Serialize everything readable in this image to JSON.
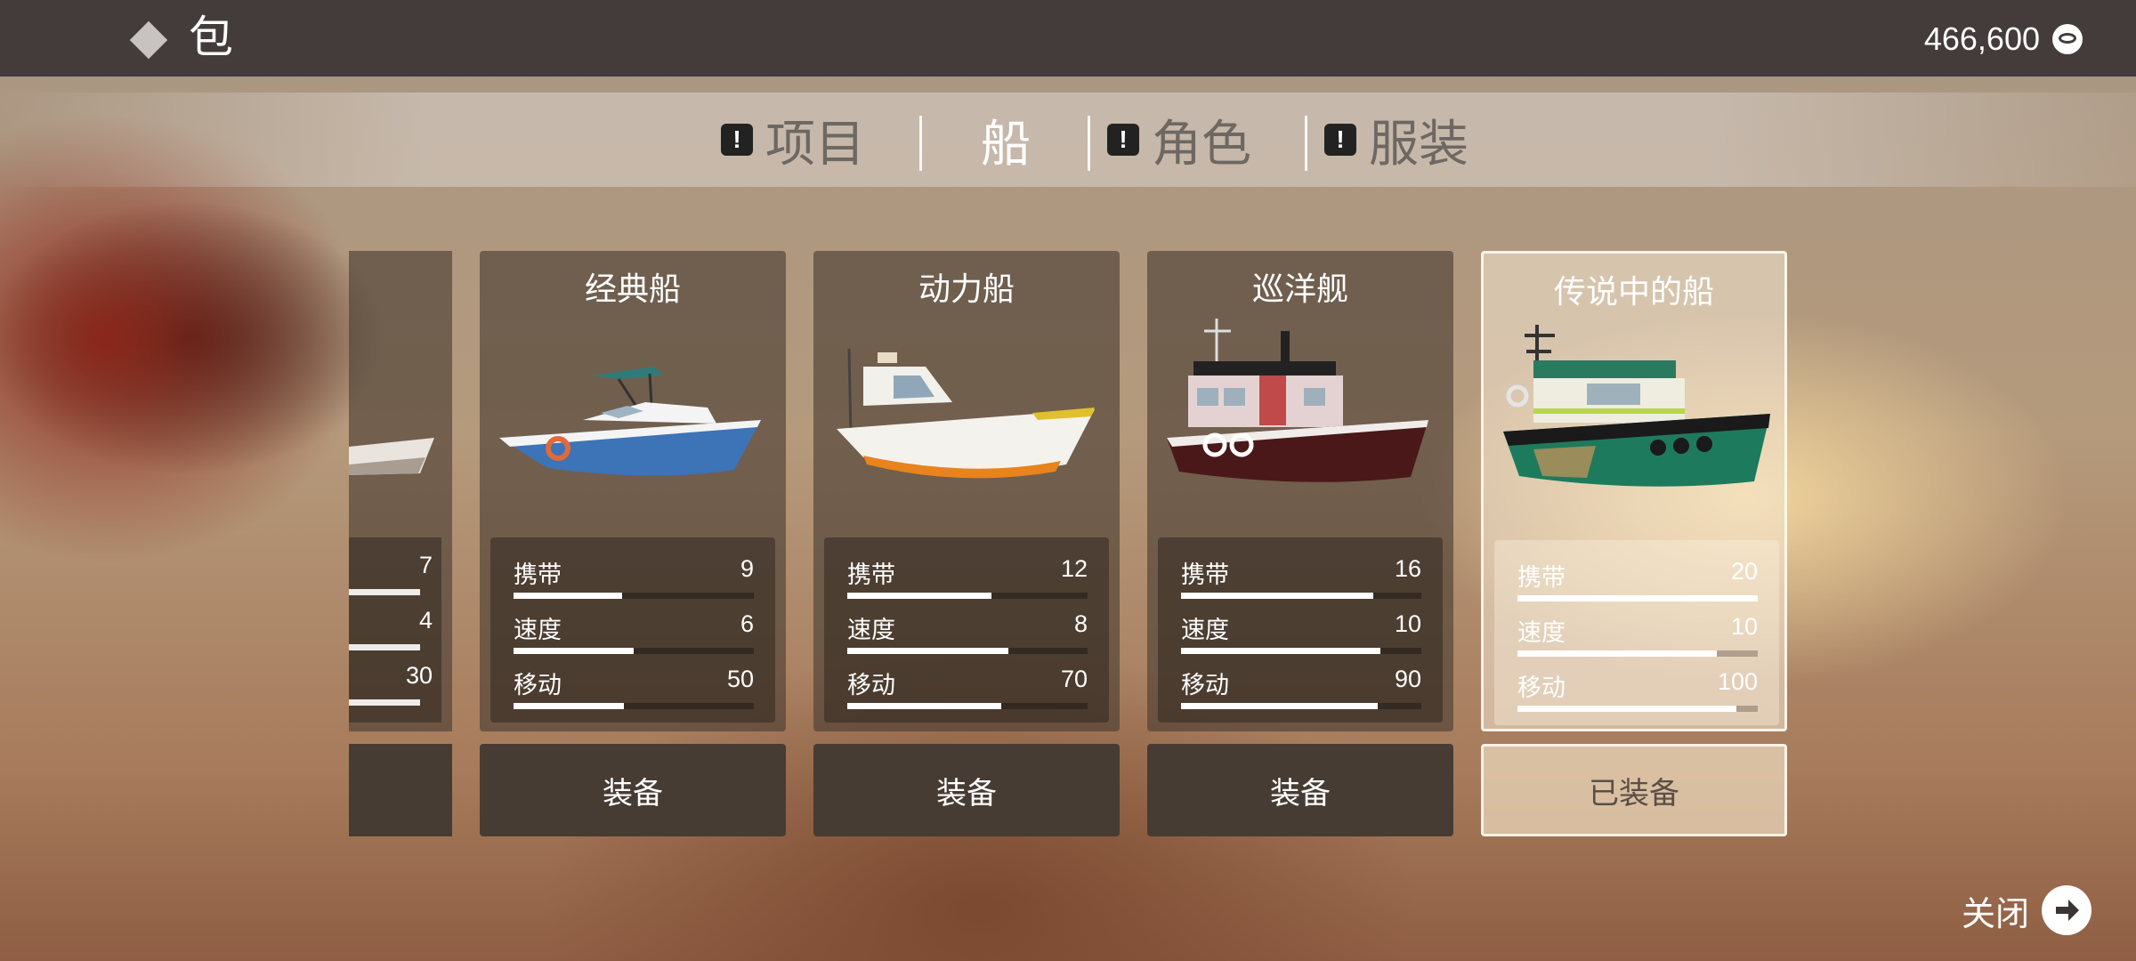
{
  "header": {
    "title": "包",
    "currency_value": "466,600",
    "currency_icon": "coin-icon"
  },
  "tabs": [
    {
      "label": "项目",
      "alert": "!",
      "active": false
    },
    {
      "label": "船",
      "alert": "",
      "active": true
    },
    {
      "label": "角色",
      "alert": "!",
      "active": false
    },
    {
      "label": "服装",
      "alert": "!",
      "active": false
    }
  ],
  "partial_card": {
    "stats": [
      "7",
      "4",
      "30"
    ]
  },
  "boats": [
    {
      "name": "经典船",
      "hull_color": "#3a73b8",
      "stats": [
        {
          "label": "携带",
          "value": "9",
          "fill": 0.45
        },
        {
          "label": "速度",
          "value": "6",
          "fill": 0.5
        },
        {
          "label": "移动",
          "value": "50",
          "fill": 0.46
        }
      ],
      "button": "装备"
    },
    {
      "name": "动力船",
      "hull_color": "#f2efe6",
      "stats": [
        {
          "label": "携带",
          "value": "12",
          "fill": 0.6
        },
        {
          "label": "速度",
          "value": "8",
          "fill": 0.67
        },
        {
          "label": "移动",
          "value": "70",
          "fill": 0.64
        }
      ],
      "button": "装备"
    },
    {
      "name": "巡洋舰",
      "hull_color": "#4a1a1a",
      "stats": [
        {
          "label": "携带",
          "value": "16",
          "fill": 0.8
        },
        {
          "label": "速度",
          "value": "10",
          "fill": 0.83
        },
        {
          "label": "移动",
          "value": "90",
          "fill": 0.82
        }
      ],
      "button": "装备"
    },
    {
      "name": "传说中的船",
      "hull_color": "#1f7a5c",
      "stats": [
        {
          "label": "携带",
          "value": "20",
          "fill": 1.0
        },
        {
          "label": "速度",
          "value": "10",
          "fill": 0.83
        },
        {
          "label": "移动",
          "value": "100",
          "fill": 0.91
        }
      ],
      "button": "已装备"
    }
  ],
  "footer": {
    "close_label": "关闭",
    "close_icon": "arrow-right-icon"
  }
}
